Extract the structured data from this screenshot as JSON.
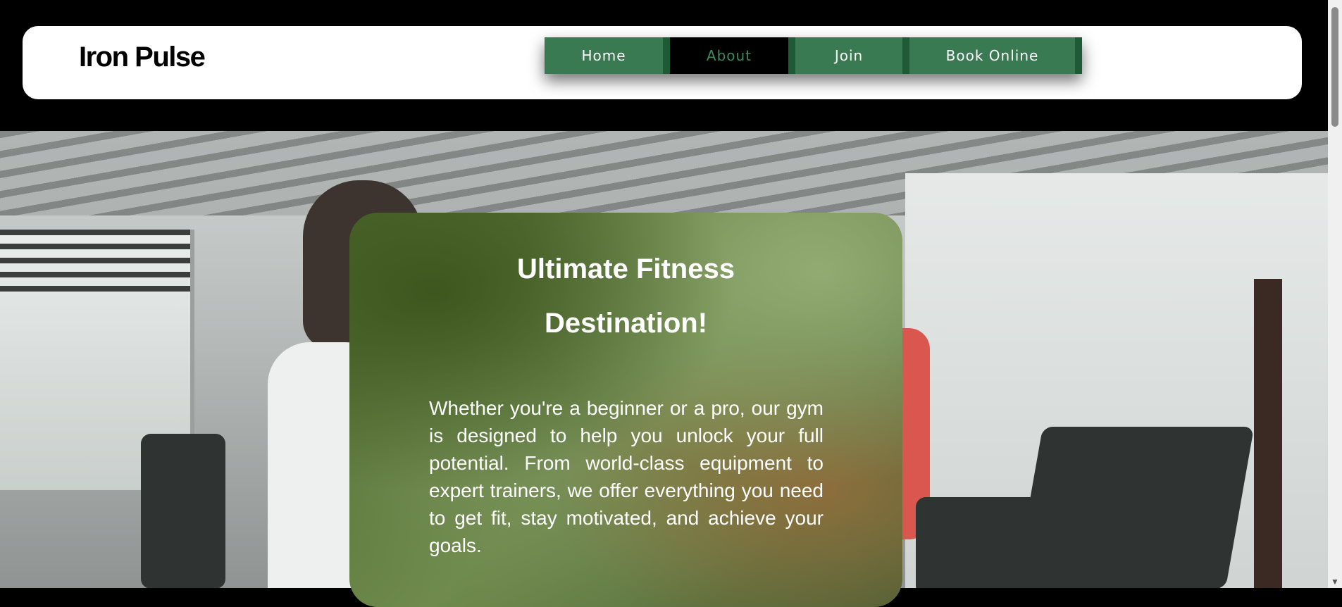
{
  "header": {
    "logo": "Iron Pulse",
    "nav": [
      {
        "label": "Home",
        "active": false
      },
      {
        "label": "About",
        "active": true
      },
      {
        "label": "Join",
        "active": false
      },
      {
        "label": "Book Online",
        "active": false
      }
    ]
  },
  "hero": {
    "title_line1": "Ultimate Fitness",
    "title_line2": "Destination!",
    "body": "Whether you're a beginner or a pro, our gym is designed to help you unlock your full potential. From world-class equipment to expert trainers, we offer everything you need to get fit, stay motivated, and achieve your goals."
  },
  "colors": {
    "nav_bg": "#3a7a52",
    "nav_active_bg": "#000000",
    "nav_active_text": "#3f8a5c",
    "page_bg": "#000000",
    "header_bg": "#ffffff"
  }
}
